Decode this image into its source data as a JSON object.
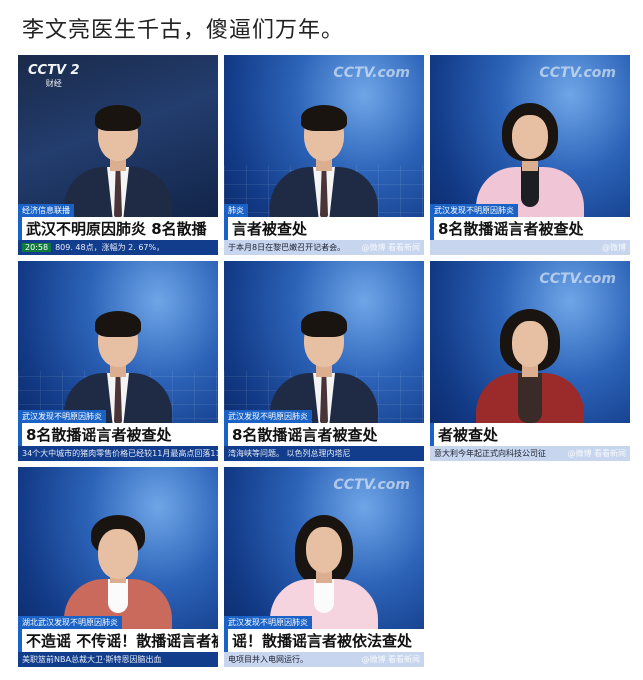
{
  "post": {
    "title": "李文亮医生千古，傻逼们万年。"
  },
  "tiles": [
    {
      "logo": "CCTV 2",
      "logo_sub": "财经",
      "tag": "经济信息联播",
      "headline": "武汉不明原因肺炎  8名散播",
      "crawl": "809. 48点，涨幅为 2. 67%，",
      "time": "20:58",
      "outfit": "suit"
    },
    {
      "logo": "CCTV.com",
      "tag": "肺炎",
      "headline": "言者被查处",
      "crawl": "于本月8日在黎巴嫩召开记者会。",
      "watermark": "@微博 看看新闻",
      "outfit": "suit"
    },
    {
      "logo": "CCTV.com",
      "tag": "武汉发现不明原因肺炎",
      "headline": "8名散播谣言者被查处",
      "crawl": "",
      "watermark": "@微博",
      "outfit": "pink"
    },
    {
      "logo": "",
      "tag": "武汉发现不明原因肺炎",
      "headline": "8名散播谣言者被查处",
      "crawl": "34个大中城市的猪肉零售价格已经较11月最高点回落11.1",
      "outfit": "suit"
    },
    {
      "logo": "",
      "tag": "武汉发现不明原因肺炎",
      "headline": "8名散播谣言者被查处",
      "crawl": "湾海峡等问题。    以色列总理内塔尼",
      "outfit": "suit"
    },
    {
      "logo": "CCTV.com",
      "tag": "",
      "headline": "者被查处",
      "crawl": "意大利今年起正式向科技公司征",
      "watermark": "@微博 看看新闻",
      "outfit": "red"
    },
    {
      "logo": "",
      "tag": "湖北武汉发现不明原因肺炎",
      "headline": "不造谣 不传谣！散播谣言者被",
      "crawl": "美职篮前NBA总裁大卫·斯特恩因脑出血",
      "outfit": "coral"
    },
    {
      "logo": "CCTV.com",
      "tag": "武汉发现不明原因肺炎",
      "headline": "谣！散播谣言者被依法查处",
      "crawl": "电项目并入电网运行。",
      "watermark": "@微博 看看新闻",
      "outfit": "light"
    }
  ]
}
